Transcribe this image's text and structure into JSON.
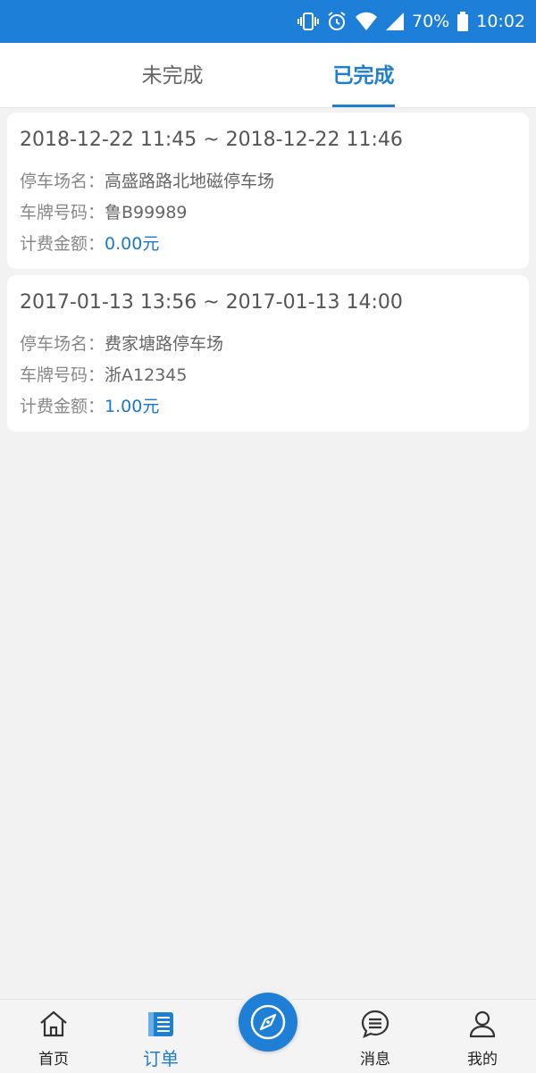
{
  "status_bar": {
    "battery": "70%",
    "time": "10:02",
    "icons": [
      "vibrate-icon",
      "alarm-icon",
      "wifi-icon",
      "signal-icon",
      "battery-icon"
    ]
  },
  "tabs": [
    {
      "label": "未完成",
      "active": false
    },
    {
      "label": "已完成",
      "active": true
    }
  ],
  "orders": [
    {
      "time_range": "2018-12-22 11:45 ~ 2018-12-22 11:46",
      "lot_label": "停车场名：",
      "lot_value": "高盛路路北地磁停车场",
      "plate_label": "车牌号码：",
      "plate_value": "鲁B99989",
      "fee_label": "计费金额：",
      "fee_value": "0.00元"
    },
    {
      "time_range": "2017-01-13 13:56 ~ 2017-01-13 14:00",
      "lot_label": "停车场名：",
      "lot_value": "费家塘路停车场",
      "plate_label": "车牌号码：",
      "plate_value": "浙A12345",
      "fee_label": "计费金额：",
      "fee_value": "1.00元"
    }
  ],
  "bottom_nav": [
    {
      "label": "首页",
      "icon": "home-icon",
      "active": false
    },
    {
      "label": "订单",
      "icon": "orders-icon",
      "active": true
    },
    {
      "label": "",
      "icon": "compass-icon",
      "active": false
    },
    {
      "label": "消息",
      "icon": "message-icon",
      "active": false
    },
    {
      "label": "我的",
      "icon": "user-icon",
      "active": false
    }
  ],
  "colors": {
    "primary": "#1f7fcf",
    "status_bar": "#1e7fd9",
    "background": "#f2f2f2",
    "amount": "#1b78c4"
  }
}
